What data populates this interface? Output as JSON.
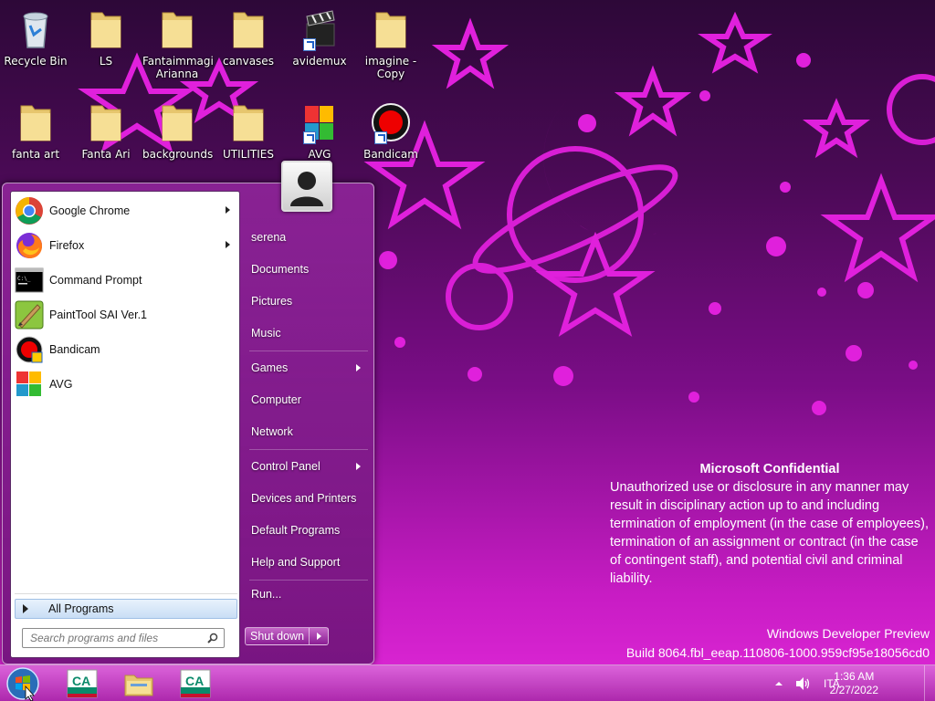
{
  "desktop": {
    "icons": [
      {
        "label": "Recycle Bin"
      },
      {
        "label": "LS"
      },
      {
        "label": "Fantaimmagi Arianna"
      },
      {
        "label": "canvases"
      },
      {
        "label": "avidemux"
      },
      {
        "label": "imagine - Copy"
      },
      {
        "label": "fanta art"
      },
      {
        "label": "Fanta Ari"
      },
      {
        "label": "backgrounds"
      },
      {
        "label": "UTILITIES"
      },
      {
        "label": "AVG"
      },
      {
        "label": "Bandicam"
      }
    ]
  },
  "watermark": {
    "title": "Microsoft Confidential",
    "body": "Unauthorized use or disclosure in any manner may result in disciplinary action up to and including termination of employment (in the case of employees), termination of an assignment or contract (in the case of contingent staff), and potential civil and criminal liability.",
    "os_name": "Windows Developer Preview",
    "build": "Build 8064.fbl_eeap.110806-1000.959cf95e18056cd0"
  },
  "start_menu": {
    "programs": [
      {
        "label": "Google Chrome",
        "icon": "chrome-icon",
        "has_submenu": true
      },
      {
        "label": "Firefox",
        "icon": "firefox-icon",
        "has_submenu": true
      },
      {
        "label": "Command Prompt",
        "icon": "cmd-icon",
        "has_submenu": false
      },
      {
        "label": "PaintTool SAI Ver.1",
        "icon": "painttool-sai-icon",
        "has_submenu": false
      },
      {
        "label": "Bandicam",
        "icon": "bandicam-icon",
        "has_submenu": false
      },
      {
        "label": "AVG",
        "icon": "avg-icon",
        "has_submenu": false
      }
    ],
    "all_programs": "All Programs",
    "search_placeholder": "Search programs and files",
    "right_items": [
      {
        "label": "serena"
      },
      {
        "label": "Documents"
      },
      {
        "label": "Pictures"
      },
      {
        "label": "Music"
      },
      {
        "label": "Games",
        "has_submenu": true
      },
      {
        "label": "Computer"
      },
      {
        "label": "Network"
      },
      {
        "label": "Control Panel",
        "has_submenu": true
      },
      {
        "label": "Devices and Printers"
      },
      {
        "label": "Default Programs"
      },
      {
        "label": "Help and Support"
      },
      {
        "label": "Run..."
      }
    ],
    "shutdown": "Shut down"
  },
  "taskbar": {
    "language": "ITA",
    "time": "1:36 AM",
    "date": "2/27/2022"
  },
  "colors": {
    "accent": "#c81cc4",
    "wallpaper_shapes": "#e020dc"
  }
}
